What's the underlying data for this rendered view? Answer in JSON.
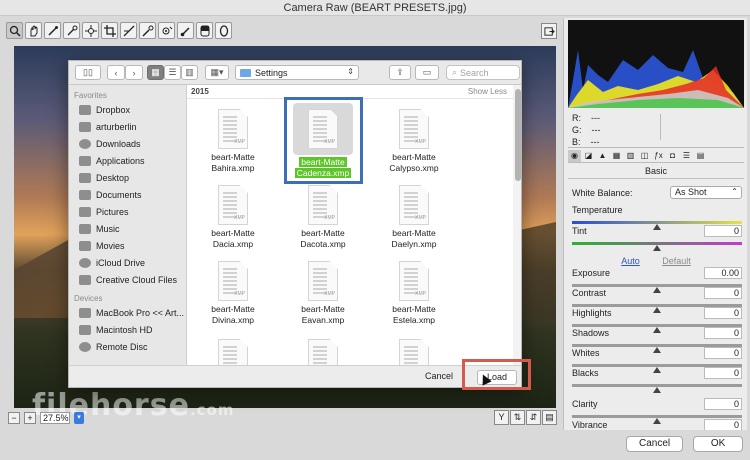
{
  "window": {
    "title": "Camera Raw (BEART PRESETS.jpg)"
  },
  "toolbar": {
    "tools": [
      "zoom-tool",
      "hand-tool",
      "white-balance-tool",
      "color-sampler-tool",
      "targeted-adjustment-tool",
      "crop-tool",
      "straighten-tool",
      "spot-removal-tool",
      "red-eye-tool",
      "adjustment-brush-tool",
      "graduated-filter-tool",
      "radial-filter-tool"
    ]
  },
  "preview": {
    "zoom_value": "27.5%",
    "watermark": "filehorse",
    "watermark_suffix": ".com"
  },
  "dialog": {
    "path": "Settings",
    "search_placeholder": "Search",
    "section_title": "2015",
    "show_less": "Show Less",
    "favorites_label": "Favorites",
    "devices_label": "Devices",
    "favorites": [
      "Dropbox",
      "arturberlin",
      "Downloads",
      "Applications",
      "Desktop",
      "Documents",
      "Pictures",
      "Music",
      "Movies",
      "iCloud Drive",
      "Creative Cloud Files"
    ],
    "devices": [
      "MacBook Pro << Art...",
      "Macintosh HD",
      "Remote Disc"
    ],
    "files": [
      {
        "line1": "beart-Matte",
        "line2": "Bahira.xmp"
      },
      {
        "line1": "beart-Matte",
        "line2": "Cadenza.xmp"
      },
      {
        "line1": "beart-Matte",
        "line2": "Calypso.xmp"
      },
      {
        "line1": "beart-Matte",
        "line2": "Dacia.xmp"
      },
      {
        "line1": "beart-Matte",
        "line2": "Dacota.xmp"
      },
      {
        "line1": "beart-Matte",
        "line2": "Daelyn.xmp"
      },
      {
        "line1": "beart-Matte",
        "line2": "Divina.xmp"
      },
      {
        "line1": "beart-Matte",
        "line2": "Eavan.xmp"
      },
      {
        "line1": "beart-Matte",
        "line2": "Estela.xmp"
      }
    ],
    "file_icon_label": "XMP",
    "cancel_label": "Cancel",
    "load_label": "Load"
  },
  "panel": {
    "rgb": {
      "r_label": "R:",
      "g_label": "G:",
      "b_label": "B:",
      "r": "---",
      "g": "---",
      "b": "---"
    },
    "section_title": "Basic",
    "white_balance_label": "White Balance:",
    "white_balance_value": "As Shot",
    "auto_label": "Auto",
    "default_label": "Default",
    "sliders": [
      {
        "label": "Temperature",
        "value": "",
        "level": 0.5
      },
      {
        "label": "Tint",
        "value": "0",
        "level": 0.5
      },
      {
        "label": "Exposure",
        "value": "0.00",
        "level": 0.5
      },
      {
        "label": "Contrast",
        "value": "0",
        "level": 0.5
      },
      {
        "label": "Highlights",
        "value": "0",
        "level": 0.5
      },
      {
        "label": "Shadows",
        "value": "0",
        "level": 0.5
      },
      {
        "label": "Whites",
        "value": "0",
        "level": 0.5
      },
      {
        "label": "Blacks",
        "value": "0",
        "level": 0.5
      },
      {
        "label": "Clarity",
        "value": "0",
        "level": 0.5
      },
      {
        "label": "Vibrance",
        "value": "0",
        "level": 0.5
      }
    ],
    "tab_icons": [
      "basic-icon",
      "tone-curve-icon",
      "detail-icon",
      "hsl-icon",
      "split-toning-icon",
      "lens-corrections-icon",
      "fx-icon",
      "camera-calibration-icon",
      "presets-icon",
      "snapshots-icon"
    ]
  },
  "footer": {
    "cancel_label": "Cancel",
    "ok_label": "OK"
  },
  "colors": {
    "selection_border": "#3d6fb6",
    "load_highlight": "#d55a4b",
    "selected_name_bg": "#5cc628",
    "link_blue": "#2a55d4"
  }
}
